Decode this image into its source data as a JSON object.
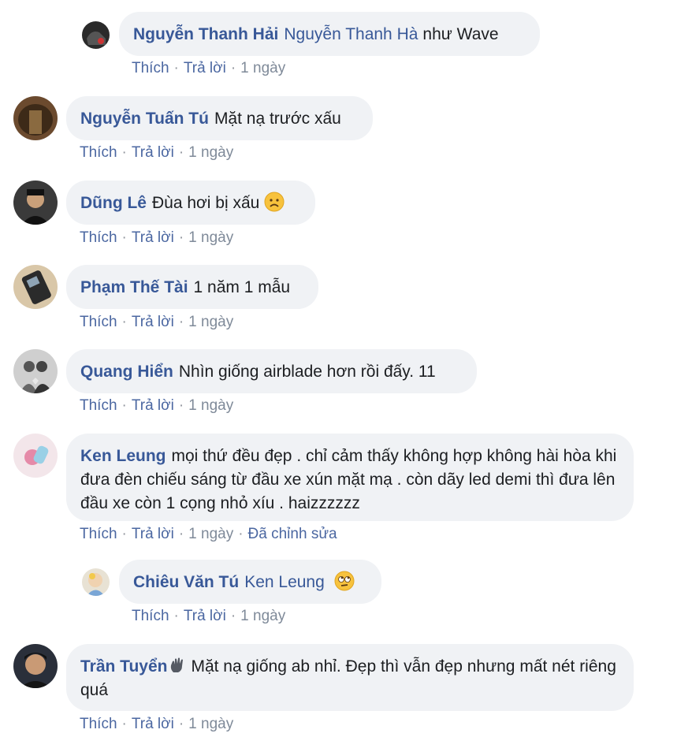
{
  "actions": {
    "like": "Thích",
    "reply": "Trả lời",
    "separator": "·"
  },
  "comments": [
    {
      "author": "Nguyễn Thanh Hải",
      "mention": "Nguyễn Thanh Hà",
      "text": "như Wave",
      "time": "1 ngày",
      "edited": "",
      "is_reply": true,
      "emoji": ""
    },
    {
      "author": "Nguyễn Tuấn Tú",
      "mention": "",
      "text": "Mặt nạ trước xấu",
      "time": "1 ngày",
      "edited": "",
      "is_reply": false,
      "emoji": ""
    },
    {
      "author": "Dũng Lê",
      "mention": "",
      "text": "Đùa hơi bị xấu",
      "time": "1 ngày",
      "edited": "",
      "is_reply": false,
      "emoji": "frowning-face"
    },
    {
      "author": "Phạm Thế Tài",
      "mention": "",
      "text": "1 năm 1 mẫu",
      "time": "1 ngày",
      "edited": "",
      "is_reply": false,
      "emoji": ""
    },
    {
      "author": "Quang Hiển",
      "mention": "",
      "text": "Nhìn giống airblade hơn rồi đấy. 11",
      "time": "1 ngày",
      "edited": "",
      "is_reply": false,
      "emoji": ""
    },
    {
      "author": "Ken Leung",
      "mention": "",
      "text": "mọi thứ đều đẹp . chỉ cảm thấy không hợp không hài hòa khi đưa đèn chiếu sáng từ đầu xe xún mặt mạ . còn dãy led demi thì đưa lên đầu xe còn 1 cọng nhỏ xíu . haizzzzzz",
      "time": "1 ngày",
      "edited": "Đã chỉnh sửa",
      "is_reply": false,
      "emoji": ""
    },
    {
      "author": "Chiêu Văn Tú",
      "mention": "Ken Leung",
      "text": "",
      "time": "1 ngày",
      "edited": "",
      "is_reply": true,
      "emoji": "rolling-eyes-face"
    },
    {
      "author": "Trần Tuyển",
      "mention": "",
      "text": "Mặt nạ giống ab nhỉ. Đẹp thì vẫn đẹp nhưng mất nét riêng quá",
      "time": "1 ngày",
      "edited": "",
      "is_reply": false,
      "emoji": "",
      "badge": "waving-hand-icon"
    }
  ]
}
